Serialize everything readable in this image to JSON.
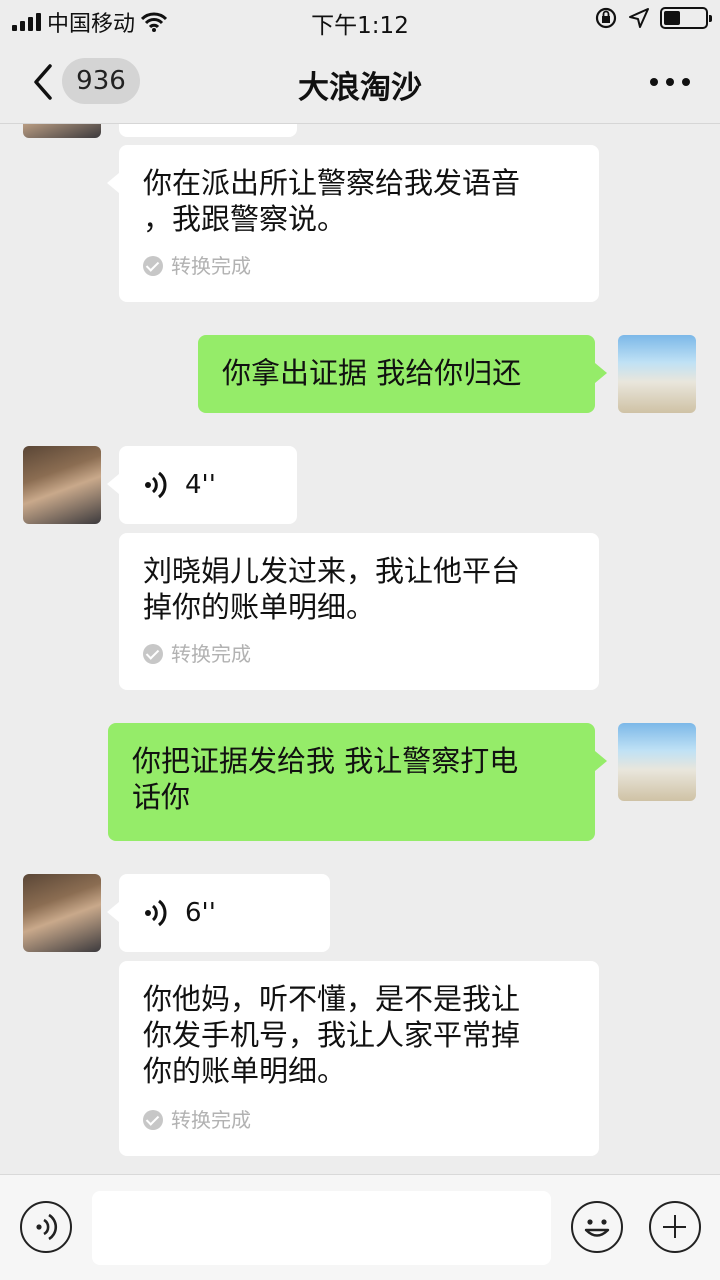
{
  "status_bar": {
    "carrier": "中国移动",
    "time": "下午1:12",
    "icons": [
      "signal-icon",
      "wifi-icon",
      "orientation-lock-icon",
      "location-icon",
      "battery-icon"
    ]
  },
  "header": {
    "back_icon": "chevron-left-icon",
    "unread_count": "936",
    "title": "大浪淘沙",
    "more_icon": "more-dots-icon"
  },
  "messages": [
    {
      "type": "text",
      "sender": "other",
      "text_lines": [
        "你在派出所让警察给我发语音",
        "，我跟警察说。"
      ],
      "caption": "转换完成"
    },
    {
      "type": "text",
      "sender": "me",
      "text_lines": [
        "你拿出证据 我给你归还"
      ]
    },
    {
      "type": "voice",
      "sender": "other",
      "duration": "4''"
    },
    {
      "type": "text",
      "sender": "other",
      "text_lines": [
        "刘晓娟儿发过来，我让他平台",
        "掉你的账单明细。"
      ],
      "caption": "转换完成"
    },
    {
      "type": "text",
      "sender": "me",
      "text_lines": [
        "你把证据发给我 我让警察打电",
        "话你"
      ]
    },
    {
      "type": "voice",
      "sender": "other",
      "duration": "6''"
    },
    {
      "type": "text",
      "sender": "other",
      "text_lines": [
        "你他妈，听不懂，是不是我让",
        "你发手机号，我让人家平常掉",
        "你的账单明细。"
      ],
      "caption": "转换完成"
    }
  ],
  "input_bar": {
    "voice_icon": "voice-input-icon",
    "input_value": "",
    "emoji_icon": "emoji-icon",
    "plus_icon": "plus-icon"
  },
  "colors": {
    "background": "#ededed",
    "bubble_me": "#95ec69",
    "bubble_other": "#ffffff",
    "caption_text": "#b2b2b2"
  }
}
